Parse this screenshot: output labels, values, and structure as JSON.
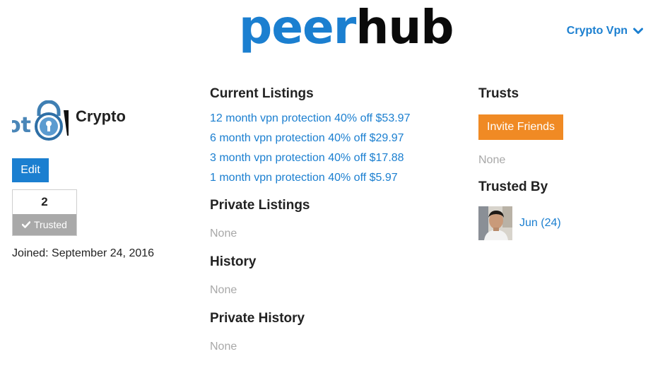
{
  "brand": {
    "part1": "peer",
    "part2": "hub",
    "color_primary": "#1b7fd0",
    "color_dark": "#0a0a0a"
  },
  "header": {
    "user_menu_label": "Crypto Vpn",
    "user_menu_icon": "chevron-down-icon"
  },
  "profile": {
    "avatar_icon": "padlock-logo-icon",
    "name": "Crypto",
    "edit_label": "Edit",
    "trust_count": "2",
    "trusted_label": "Trusted",
    "trusted_icon": "check-icon",
    "joined": "Joined: September 24, 2016"
  },
  "listings": {
    "current_title": "Current Listings",
    "current": [
      "12 month vpn protection 40% off $53.97",
      "6 month vpn protection 40% off $29.97",
      "3 month vpn protection 40% off $17.88",
      "1 month vpn protection 40% off $5.97"
    ],
    "private_title": "Private Listings",
    "private_value": "None",
    "history_title": "History",
    "history_value": "None",
    "private_history_title": "Private History",
    "private_history_value": "None"
  },
  "trusts": {
    "title": "Trusts",
    "invite_label": "Invite Friends",
    "invite_color": "#f08a24",
    "value": "None",
    "trusted_by_title": "Trusted By",
    "trusted_by": [
      {
        "name": "Jun (24)"
      }
    ]
  }
}
